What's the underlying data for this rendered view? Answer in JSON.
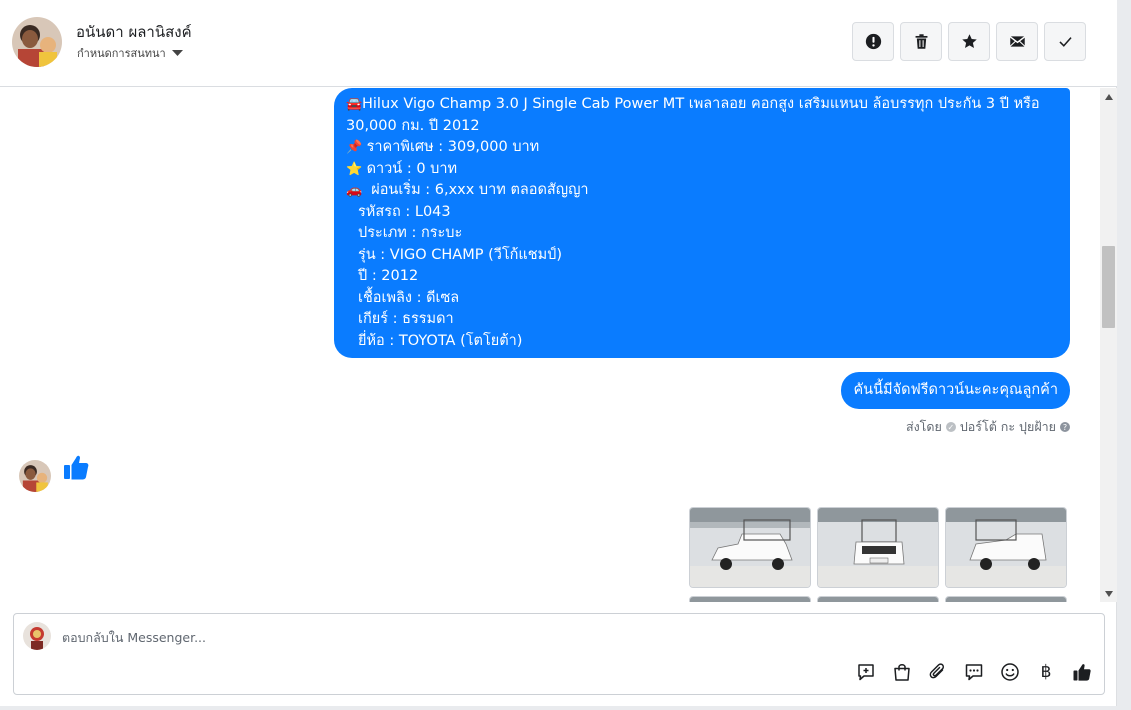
{
  "header": {
    "name": "อนันดา ผลานิสงค์",
    "subtitle": "กำหนดการสนทนา",
    "actions": [
      "alert-icon",
      "trash-icon",
      "star-icon",
      "mail-icon",
      "check-icon"
    ]
  },
  "messages": {
    "main": {
      "title_emoji": "🚘",
      "title": "Hilux Vigo Champ 3.0 J Single Cab Power MT เพลาลอย คอกสูง เสริมแหนบ ล้อบรรทุก ประกัน 3 ปี หรือ 30,000 กม. ปี 2012",
      "price_emoji": "📌",
      "price": " ราคาพิเศษ : 309,000 บาท",
      "down_emoji": "⭐",
      "down": " ดาวน์ : 0 บาท",
      "installment_emoji": "🚗",
      "installment": "  ผ่อนเริ่ม : 6,xxx บาท ตลอดสัญญา",
      "car_code": "รหัสรถ : L043",
      "type": "ประเภท : กระบะ",
      "model": "รุ่น : VIGO CHAMP (วีโก้แชมป์)",
      "year": "ปี : 2012",
      "fuel": "เชื้อเพลิง : ดีเซล",
      "gear": "เกียร์ : ธรรมดา",
      "brand": "ยี่ห้อ : TOYOTA (โตโยต้า)"
    },
    "small": "คันนี้มีจัดฟรีดาวน์นะคะคุณลูกค้า",
    "sent_by_label": "ส่งโดย",
    "sent_by_name": "ปอร์โต้ กะ ปุยฝ้าย",
    "like_icon": "thumbs-up-icon"
  },
  "composer": {
    "placeholder": "ตอบกลับใน Messenger...",
    "tools": [
      "chat-plus-icon",
      "bag-icon",
      "paperclip-icon",
      "speech-bubble-icon",
      "smiley-icon",
      "baht-icon",
      "thumbs-up-icon"
    ],
    "baht": "฿"
  },
  "colors": {
    "bubble": "#0a7cff",
    "icon": "#1c1e21"
  }
}
